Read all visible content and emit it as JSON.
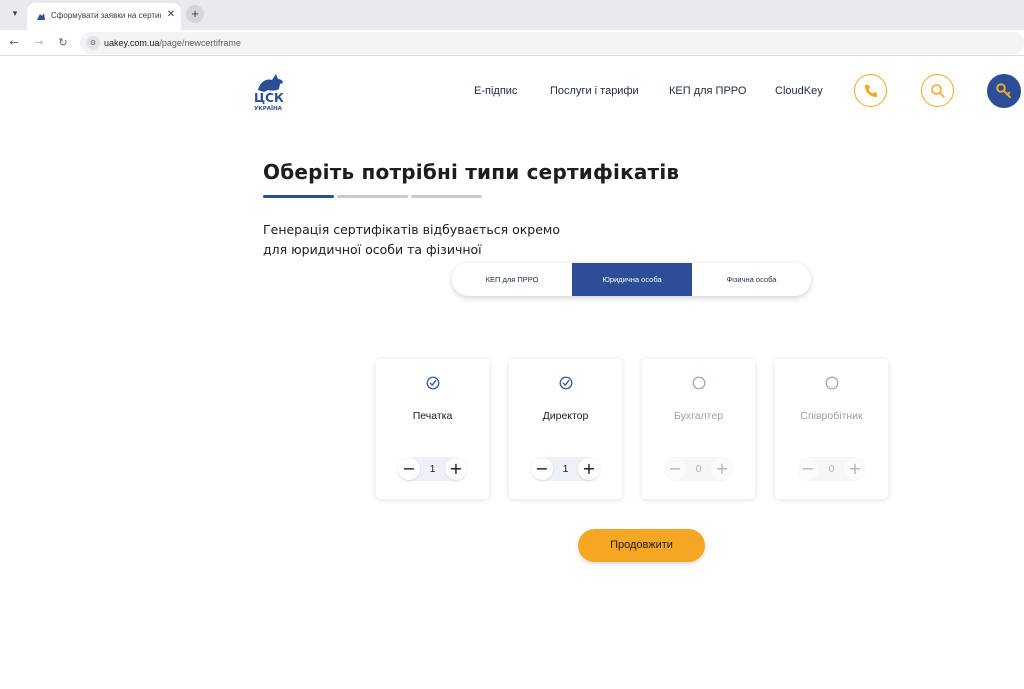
{
  "browser": {
    "tab_title": "Сформувати заявки на сертиф",
    "close_glyph": "✕",
    "new_tab_glyph": "+",
    "url_host": "uakey.com.ua",
    "url_path": "/page/newcertiframe"
  },
  "header": {
    "logo_alt": "ЦСК Україна",
    "nav": [
      "Е-підпис",
      "Послуги і тарифи",
      "КЕП для ПРРО",
      "CloudKey"
    ],
    "icons": [
      "phone-icon",
      "search-icon",
      "key-icon"
    ]
  },
  "main": {
    "title": "Оберіть потрібні типи сертифікатів",
    "steps_total": 3,
    "steps_active": 1,
    "description_line1": "Генерація сертифікатів відбувається окремо",
    "description_line2": "для юридичної особи та фізичної",
    "tabs": [
      {
        "label": "КЕП для ПРРО",
        "active": false
      },
      {
        "label": "Юридична особа",
        "active": true
      },
      {
        "label": "Фізична особа",
        "active": false
      }
    ],
    "cards": [
      {
        "label": "Печатка",
        "count": "1",
        "checked": true
      },
      {
        "label": "Директор",
        "count": "1",
        "checked": true
      },
      {
        "label": "Бухгалтер",
        "count": "0",
        "checked": false
      },
      {
        "label": "Співробітник",
        "count": "0",
        "checked": false
      }
    ],
    "stepper_minus": "−",
    "stepper_plus": "+",
    "continue_label": "Продовжити"
  },
  "colors": {
    "brand_blue": "#2c4e96",
    "accent_orange": "#f5a623"
  }
}
